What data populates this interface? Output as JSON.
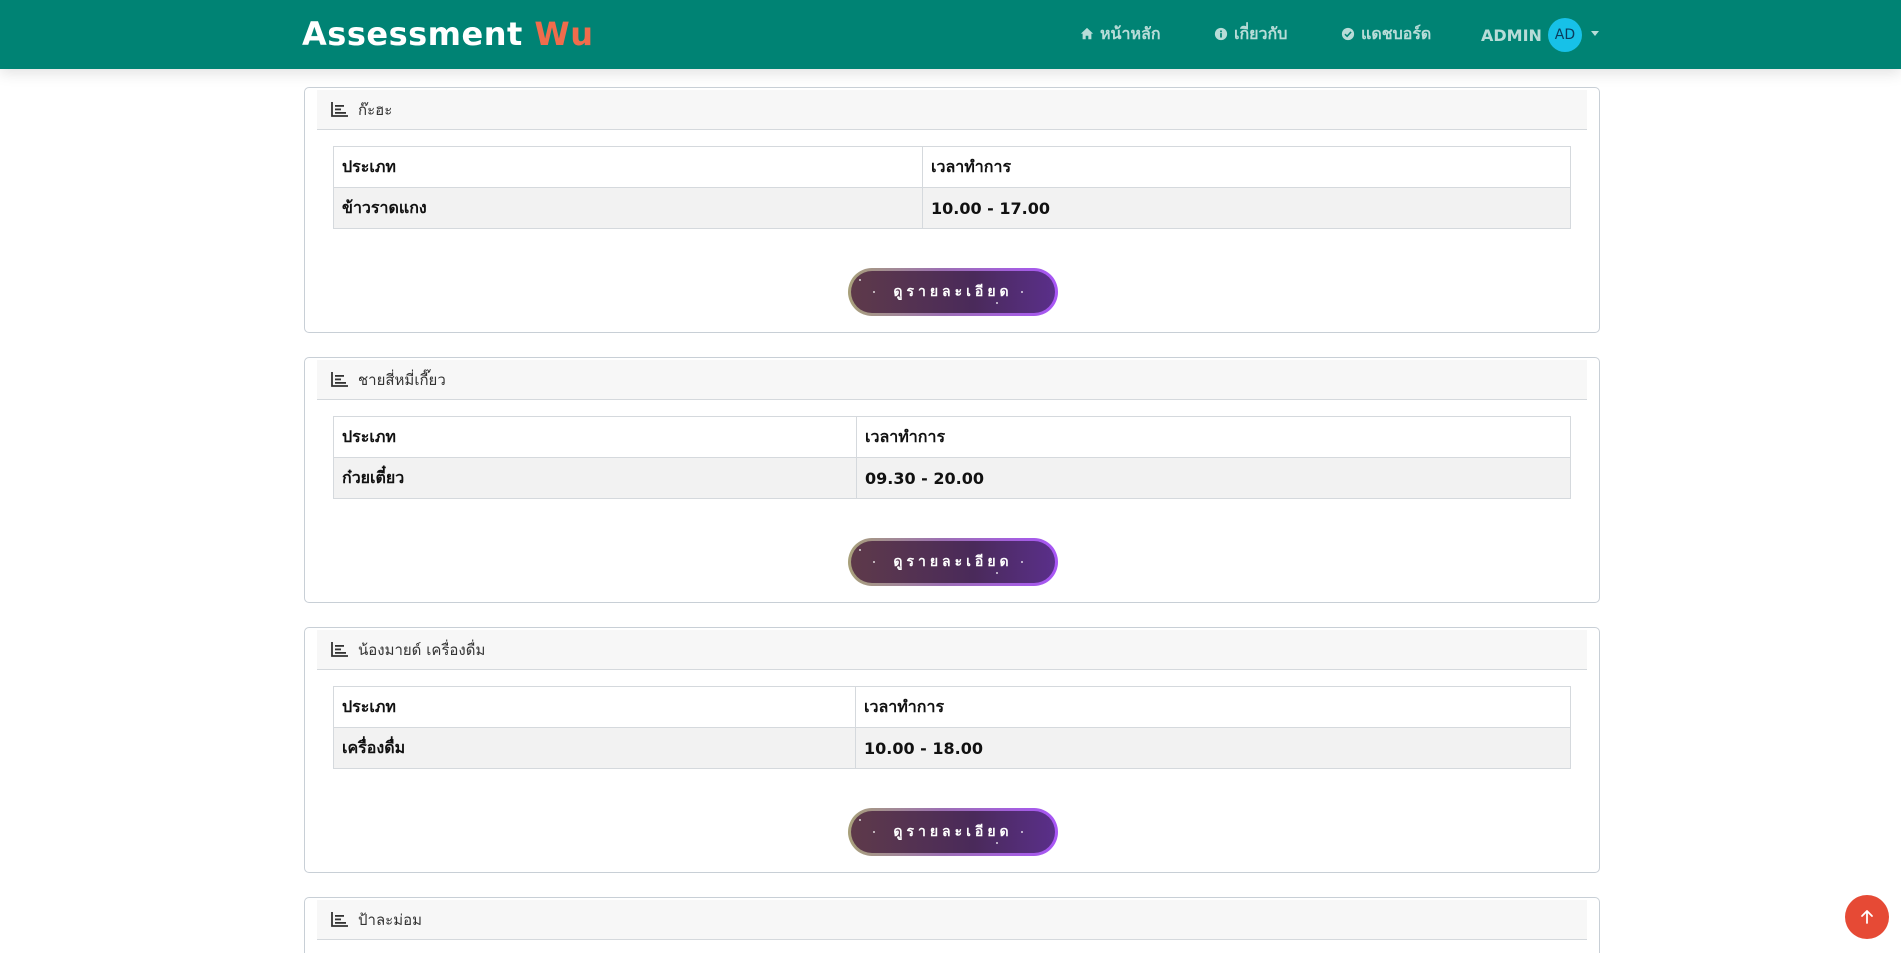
{
  "navbar": {
    "brand_main": "Assessment",
    "brand_accent": "Wu",
    "links": [
      {
        "label": "หน้าหลัก",
        "icon": "home-icon"
      },
      {
        "label": "เกี่ยวกับ",
        "icon": "info-icon"
      },
      {
        "label": "แดชบอร์ด",
        "icon": "check-circle-icon"
      }
    ],
    "user": {
      "name": "ADMIN",
      "initials": "AD"
    },
    "colors": {
      "bar": "#008374",
      "accent": "#f06c4c",
      "avatar": "#17c1e8"
    }
  },
  "shops": [
    {
      "name": "ก๊ะฮะ",
      "header_type": "ประเภท",
      "header_time": "เวลาทำการ",
      "type": "ข้าวราดแกง",
      "time": "10.00 - 17.00",
      "button_label": "ดูรายละเอียด"
    },
    {
      "name": "ชายสี่หมี่เกี๊ยว",
      "header_type": "ประเภท",
      "header_time": "เวลาทำการ",
      "type": "ก๋วยเตี๋ยว",
      "time": "09.30 - 20.00",
      "button_label": "ดูรายละเอียด"
    },
    {
      "name": "น้องมายด์ เครื่องดื่ม",
      "header_type": "ประเภท",
      "header_time": "เวลาทำการ",
      "type": "เครื่องดื่ม",
      "time": "10.00 - 18.00",
      "button_label": "ดูรายละเอียด"
    },
    {
      "name": "ป้าละม่อม"
    }
  ],
  "scroll_top": {
    "icon": "arrow-up-icon",
    "color": "#e64a35"
  }
}
